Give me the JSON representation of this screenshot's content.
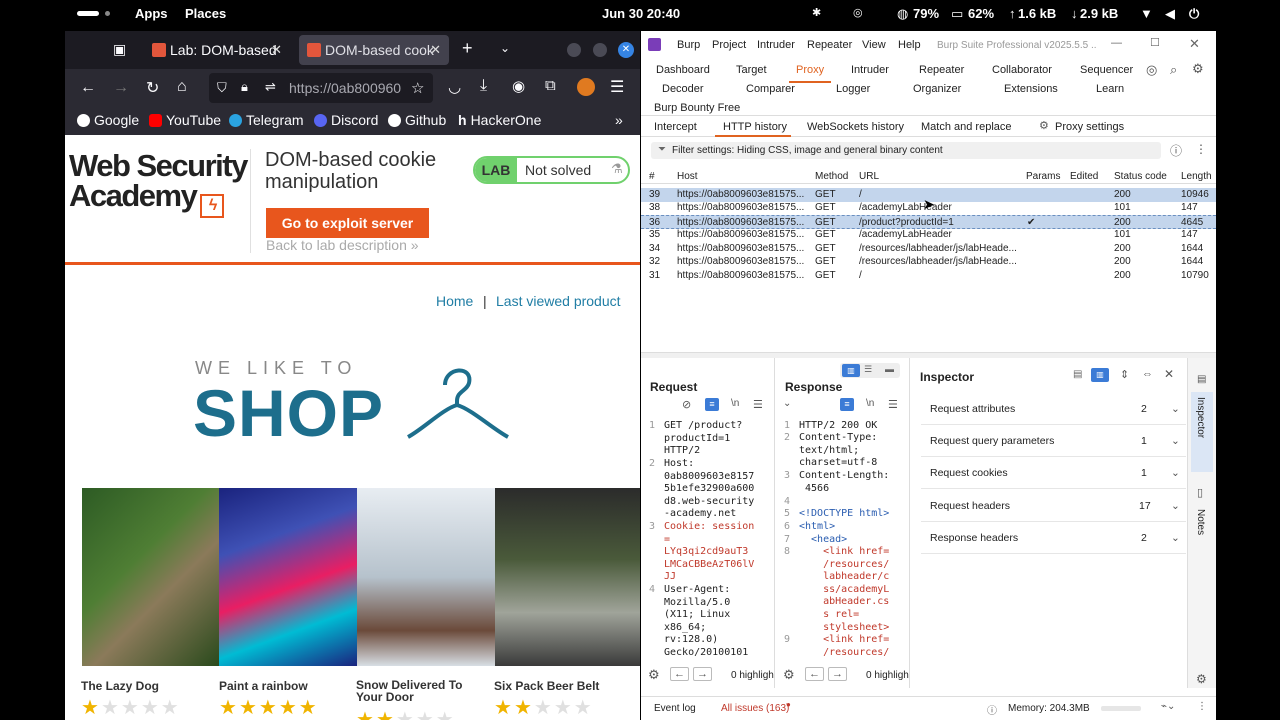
{
  "topbar": {
    "apps": "Apps",
    "places": "Places",
    "clock": "Jun 30  20:40",
    "cpu": "79%",
    "mem": "62%",
    "up": "1.6 kB",
    "down": "2.9 kB"
  },
  "firefox": {
    "tabs": [
      {
        "label": "Lab: DOM-based"
      },
      {
        "label": "DOM-based cook"
      }
    ],
    "url": "https://0ab800960",
    "bookmarks": [
      "Google",
      "YouTube",
      "Telegram",
      "Discord",
      "Github",
      "HackerOne"
    ],
    "page": {
      "logo_line1": "Web Security",
      "logo_line2": "Academy",
      "lab_title": "DOM-based cookie manipulation",
      "lab_badge": "LAB",
      "lab_status": "Not solved",
      "exploit_button": "Go to exploit server",
      "back_link": "Back to lab description",
      "nav_home": "Home",
      "nav_sep": "|",
      "nav_last": "Last viewed product",
      "hero_small": "WE LIKE TO",
      "hero_big": "SHOP",
      "products": [
        {
          "name": "The Lazy Dog",
          "stars": 1
        },
        {
          "name": "Paint a rainbow",
          "stars": 5
        },
        {
          "name": "Snow Delivered To Your Door",
          "stars": 2
        },
        {
          "name": "Six Pack Beer Belt",
          "stars": 2
        }
      ]
    }
  },
  "burp": {
    "menu": [
      "Burp",
      "Project",
      "Intruder",
      "Repeater",
      "View",
      "Help"
    ],
    "title": "Burp Suite Professional v2025.5.5 ...",
    "tabs_row1": [
      "Dashboard",
      "Target",
      "Proxy",
      "Intruder",
      "Repeater",
      "Collaborator",
      "Sequencer"
    ],
    "tabs_row2": [
      "Decoder",
      "Comparer",
      "Logger",
      "Organizer",
      "Extensions",
      "Learn"
    ],
    "tabs_row3": [
      "Burp Bounty Free"
    ],
    "subtabs": [
      "Intercept",
      "HTTP history",
      "WebSockets history",
      "Match and replace",
      "Proxy settings"
    ],
    "filter": "Filter settings: Hiding CSS, image and general binary content",
    "columns": [
      "#",
      "Host",
      "Method",
      "URL",
      "Params",
      "Edited",
      "Status code",
      "Length"
    ],
    "rows": [
      {
        "n": "39",
        "host": "https://0ab8009603e81575...",
        "method": "GET",
        "url": "/",
        "params": "",
        "status": "200",
        "len": "10946"
      },
      {
        "n": "38",
        "host": "https://0ab8009603e81575...",
        "method": "GET",
        "url": "/academyLabHeader",
        "params": "",
        "status": "101",
        "len": "147"
      },
      {
        "n": "36",
        "host": "https://0ab8009603e81575...",
        "method": "GET",
        "url": "/product?productId=1",
        "params": "✔",
        "status": "200",
        "len": "4645"
      },
      {
        "n": "35",
        "host": "https://0ab8009603e81575...",
        "method": "GET",
        "url": "/academyLabHeader",
        "params": "",
        "status": "101",
        "len": "147"
      },
      {
        "n": "34",
        "host": "https://0ab8009603e81575...",
        "method": "GET",
        "url": "/resources/labheader/js/labHeade...",
        "params": "",
        "status": "200",
        "len": "1644"
      },
      {
        "n": "32",
        "host": "https://0ab8009603e81575...",
        "method": "GET",
        "url": "/resources/labheader/js/labHeade...",
        "params": "",
        "status": "200",
        "len": "1644"
      },
      {
        "n": "31",
        "host": "https://0ab8009603e81575...",
        "method": "GET",
        "url": "/",
        "params": "",
        "status": "200",
        "len": "10790"
      }
    ],
    "request_title": "Request",
    "response_title": "Response",
    "request_lines": [
      {
        "n": "1",
        "text": "GET /product?\nproductId=1\nHTTP/2"
      },
      {
        "n": "2",
        "text": "Host:\n0ab8009603e8157\n5b1efe32900a600\nd8.web-security\n-academy.net"
      },
      {
        "n": "3",
        "text": "Cookie: session\n=\nLYq3qi2cd9auT3\nLMCaCBBeAzT06lV\nJJ"
      },
      {
        "n": "4",
        "text": "User-Agent:\nMozilla/5.0\n(X11; Linux\nx86_64;\nrv:128.0)\nGecko/20100101"
      }
    ],
    "response_lines": [
      {
        "n": "1",
        "text": "HTTP/2 200 OK"
      },
      {
        "n": "2",
        "text": "Content-Type:\ntext/html;\ncharset=utf-8"
      },
      {
        "n": "3",
        "text": "Content-Length:\n 4566"
      },
      {
        "n": "4",
        "text": ""
      },
      {
        "n": "5",
        "text": "<!DOCTYPE html>"
      },
      {
        "n": "6",
        "text": "<html>"
      },
      {
        "n": "7",
        "text": "  <head>"
      },
      {
        "n": "8",
        "text": "    <link href=\n    /resources/\n    labheader/c\n    ss/academyL\n    abHeader.cs\n    s rel=\n    stylesheet>"
      },
      {
        "n": "9",
        "text": "    <link href=\n    /resources/"
      }
    ],
    "highlight_req": "0 highligh",
    "highlight_resp": "0 highligh",
    "inspector_title": "Inspector",
    "inspector_rows": [
      {
        "label": "Request attributes",
        "count": "2"
      },
      {
        "label": "Request query parameters",
        "count": "1"
      },
      {
        "label": "Request cookies",
        "count": "1"
      },
      {
        "label": "Request headers",
        "count": "17"
      },
      {
        "label": "Response headers",
        "count": "2"
      }
    ],
    "side_tabs": [
      "Inspector",
      "Notes"
    ],
    "status": {
      "event_log": "Event log",
      "issues": "All issues (163)",
      "memory": "Memory: 204.3MB"
    }
  }
}
